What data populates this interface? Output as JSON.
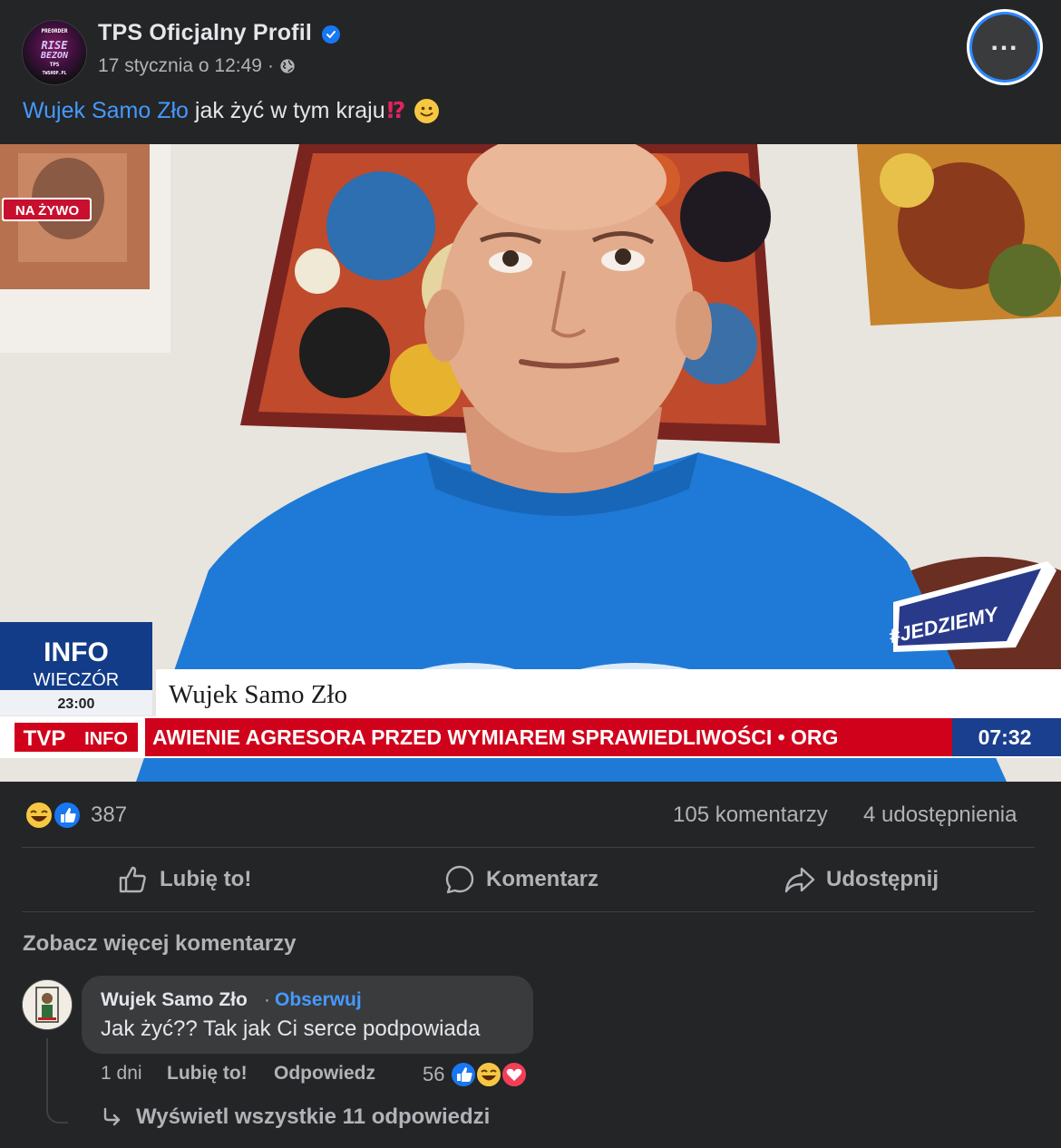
{
  "post": {
    "page_name": "TPS Oficjalny Profil",
    "timestamp": "17 stycznia o 12:49",
    "meta_separator": "·",
    "text_mention": "Wujek Samo Zło",
    "text_body": "jak żyć w tym kraju",
    "text_emoji": "⁉",
    "avatar_lines": [
      "PREORDER",
      "RISE",
      "BEZON",
      "TPS",
      "TWSHOP.PL"
    ]
  },
  "video": {
    "live_badge": "NA ŻYWO",
    "hashtag_badge": "#JEDZIEMY",
    "program_title": "INFO",
    "program_subtitle": "WIECZÓR",
    "program_time": "23:00",
    "lower_third_name": "Wujek Samo Zło",
    "channel_tvp": "TVP",
    "channel_info": "INFO",
    "ticker_text": "AWIENIE AGRESORA PRZED WYMIAREM SPRAWIEDLIWOŚCI • ORG",
    "clock": "07:32"
  },
  "stats": {
    "reactions": "387",
    "comments": "105 komentarzy",
    "shares": "4 udostępnienia"
  },
  "actions": {
    "like": "Lubię to!",
    "comment": "Komentarz",
    "share": "Udostępnij"
  },
  "comments": {
    "see_more": "Zobacz więcej komentarzy",
    "items": [
      {
        "author": "Wujek Samo Zło",
        "follow": "Obserwuj",
        "text": "Jak żyć?? Tak jak Ci serce podpowiada",
        "age": "1 dni",
        "like": "Lubię to!",
        "reply": "Odpowiedz",
        "reaction_count": "56",
        "replies_link": "Wyświetl wszystkie 11 odpowiedzi"
      }
    ]
  },
  "colors": {
    "background": "#242526",
    "link": "#4599ff",
    "secondary_text": "#b0b3b8",
    "tvp_red": "#d0021b"
  }
}
